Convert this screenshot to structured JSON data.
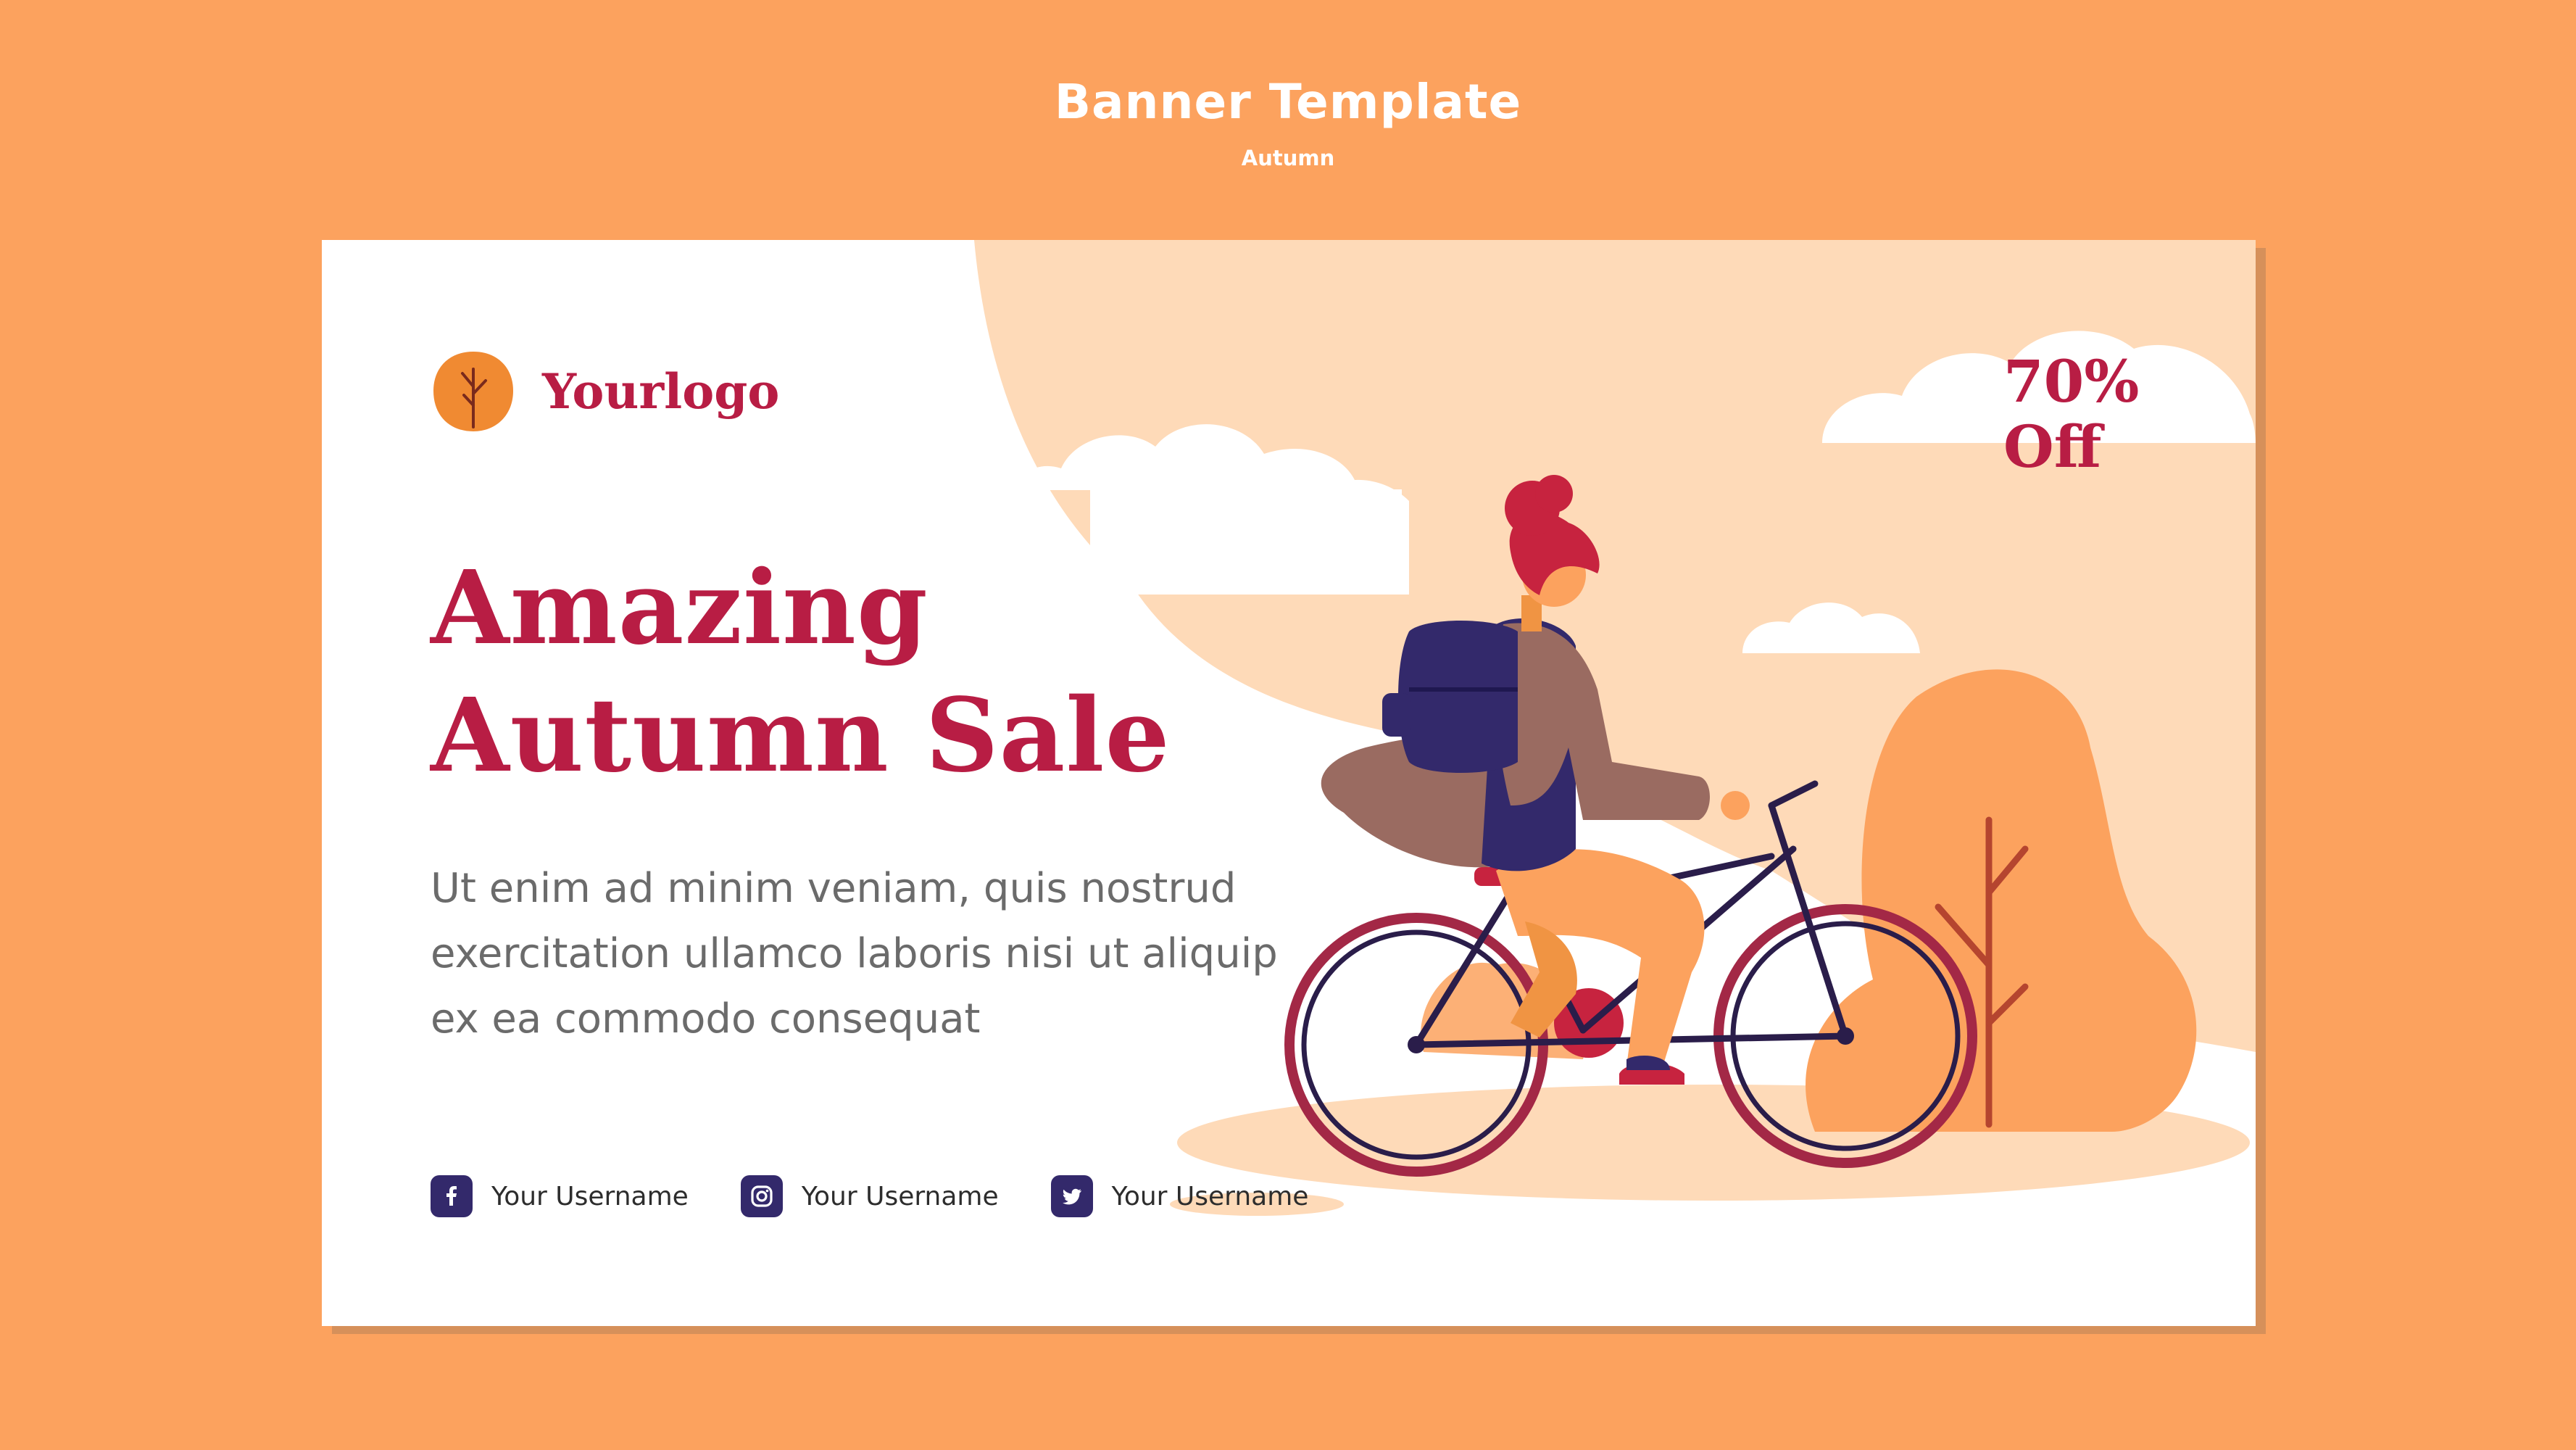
{
  "page": {
    "title": "Banner Template",
    "subtitle": "Autumn"
  },
  "banner": {
    "logo_text": "Yourlogo",
    "headline_line1": "Amazing",
    "headline_line2": "Autumn Sale",
    "body_line1": "Ut enim ad minim veniam, quis nostrud",
    "body_line2": "exercitation ullamco laboris nisi ut aliquip",
    "body_line3": "ex ea commodo consequat",
    "discount_line1": "70%",
    "discount_line2": "Off",
    "socials": [
      {
        "icon": "facebook-icon",
        "label": "Your Username"
      },
      {
        "icon": "instagram-icon",
        "label": "Your Username"
      },
      {
        "icon": "twitter-icon",
        "label": "Your Username"
      }
    ]
  },
  "colors": {
    "page_background": "#FCA25E",
    "banner_background": "#FFFFFF",
    "accent_red": "#B81D44",
    "peach": "#FEDAB8",
    "orange": "#FCA25E",
    "navy": "#33296B",
    "text_gray": "#6B6B6B"
  }
}
